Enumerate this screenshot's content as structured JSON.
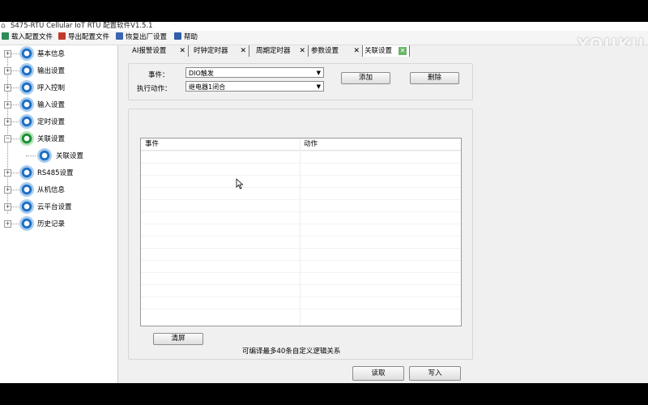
{
  "window": {
    "title": "S475-RTU Cellular IoT RTU 配置软件V1.5.1"
  },
  "menu": [
    {
      "label": "载入配置文件",
      "icon": "load-file-icon"
    },
    {
      "label": "导出配置文件",
      "icon": "export-file-icon"
    },
    {
      "label": "恢复出厂设置",
      "icon": "factory-reset-icon"
    },
    {
      "label": "帮助",
      "icon": "help-icon"
    }
  ],
  "watermark": "YOUKU",
  "sidebar": {
    "items": [
      {
        "label": "基本信息"
      },
      {
        "label": "输出设置"
      },
      {
        "label": "呼入控制"
      },
      {
        "label": "输入设置"
      },
      {
        "label": "定时设置"
      },
      {
        "label": "关联设置",
        "expanded": true,
        "children": [
          {
            "label": "关联设置"
          }
        ]
      },
      {
        "label": "RS485设置"
      },
      {
        "label": "从机信息"
      },
      {
        "label": "云平台设置"
      },
      {
        "label": "历史记录"
      }
    ]
  },
  "tabs": [
    {
      "label": "AI报警设置"
    },
    {
      "label": "时钟定时器"
    },
    {
      "label": "周期定时器"
    },
    {
      "label": "参数设置"
    },
    {
      "label": "关联设置",
      "active": true
    }
  ],
  "form": {
    "event_label": "事件：",
    "event_value": "DIO触发",
    "action_label": "执行动作：",
    "action_value": "继电器1闭合",
    "add_button": "添加",
    "delete_button": "删除"
  },
  "table": {
    "columns": [
      "事件",
      "动作"
    ],
    "rows": []
  },
  "bottom": {
    "clear_button": "清屏",
    "note": "可编译最多40条自定义逻辑关系",
    "read_button": "读取",
    "write_button": "写入"
  },
  "colors": {
    "accent_blue": "#1f6fc4",
    "active_green": "#1d8f3a"
  }
}
